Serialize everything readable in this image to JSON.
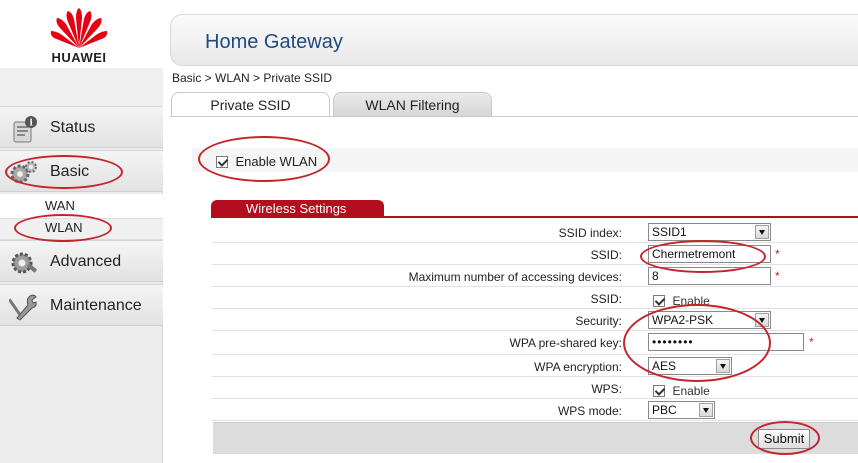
{
  "brand": {
    "logo_text": "HUAWEI",
    "logo_color": "#e60012"
  },
  "header": {
    "title": "Home Gateway"
  },
  "breadcrumb": "Basic > WLAN > Private SSID",
  "tabs": [
    {
      "label": "Private SSID",
      "active": true
    },
    {
      "label": "WLAN Filtering",
      "active": false
    }
  ],
  "sidebar": {
    "items": [
      {
        "label": "Status",
        "icon": "status-icon"
      },
      {
        "label": "Basic",
        "icon": "basic-gear-icon"
      },
      {
        "label": "Advanced",
        "icon": "advanced-gear-icon"
      },
      {
        "label": "Maintenance",
        "icon": "maintenance-wrench-icon"
      }
    ],
    "subitems": [
      {
        "label": "WAN"
      },
      {
        "label": "WLAN",
        "active": true
      }
    ]
  },
  "enable_wlan": {
    "label": "Enable WLAN",
    "checked": true
  },
  "section_title": "Wireless Settings",
  "form": {
    "ssid_index": {
      "label": "SSID index:",
      "value": "SSID1"
    },
    "ssid_name": {
      "label": "SSID:",
      "value": "Chermetremont",
      "required": "*"
    },
    "max_devices": {
      "label": "Maximum number of accessing devices:",
      "value": "8",
      "required": "*"
    },
    "ssid_enable": {
      "label": "SSID:",
      "checkbox_label": "Enable",
      "checked": true
    },
    "security": {
      "label": "Security:",
      "value": "WPA2-PSK"
    },
    "wpa_key": {
      "label": "WPA pre-shared key:",
      "value": "••••••••",
      "required": "*"
    },
    "wpa_encryption": {
      "label": "WPA encryption:",
      "value": "AES"
    },
    "wps": {
      "label": "WPS:",
      "checkbox_label": "Enable",
      "checked": true
    },
    "wps_mode": {
      "label": "WPS mode:",
      "value": "PBC"
    }
  },
  "submit_label": "Submit",
  "colors": {
    "accent_red": "#b30e1d",
    "annotation_red": "#c2252b",
    "title_blue": "#1e4a80"
  }
}
